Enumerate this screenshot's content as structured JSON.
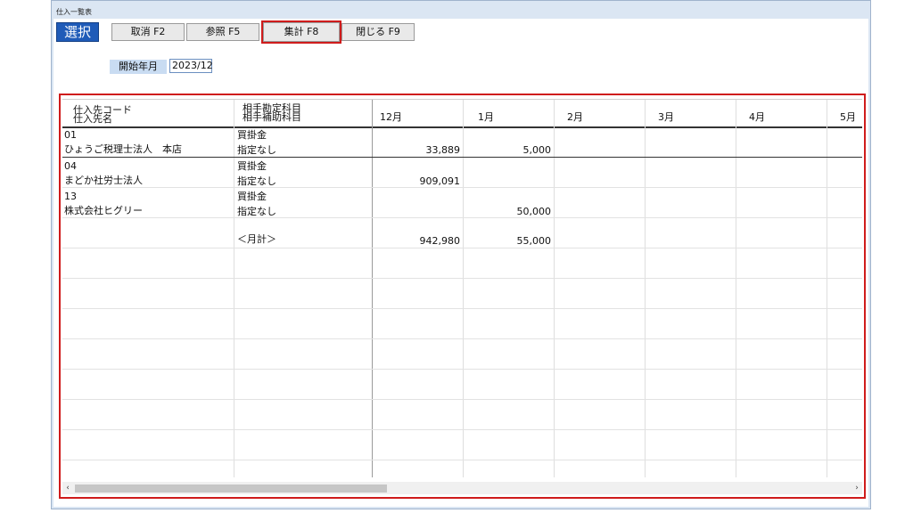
{
  "window": {
    "title": "仕入一覧表"
  },
  "toolbar": {
    "select_label": "選択",
    "cancel_label": "取消 F2",
    "refer_label": "参照 F5",
    "aggregate_label": "集計 F8",
    "close_label": "閉じる F9"
  },
  "filter": {
    "start_label": "開始年月",
    "start_value": "2023/12"
  },
  "table": {
    "headers": {
      "code": "仕入先コード",
      "name": "仕入先名",
      "account": "相手勘定科目",
      "sub_account": "相手補助科目",
      "months": [
        "12月",
        "1月",
        "2月",
        "3月",
        "4月",
        "5月"
      ]
    },
    "rows": [
      {
        "code": "01",
        "name": "ひょうご税理士法人　本店",
        "account": "買掛金",
        "sub_account": "指定なし",
        "m12": "33,889",
        "m1": "5,000"
      },
      {
        "code": "04",
        "name": "まどか社労士法人",
        "account": "買掛金",
        "sub_account": "指定なし",
        "m12": "909,091",
        "m1": ""
      },
      {
        "code": "13",
        "name": "株式会社ヒグリー",
        "account": "買掛金",
        "sub_account": "指定なし",
        "m12": "",
        "m1": "50,000"
      }
    ],
    "total": {
      "label": "＜月計＞",
      "m12": "942,980",
      "m1": "55,000"
    }
  },
  "scrollbar": {
    "left_arrow": "‹",
    "right_arrow": "›"
  }
}
